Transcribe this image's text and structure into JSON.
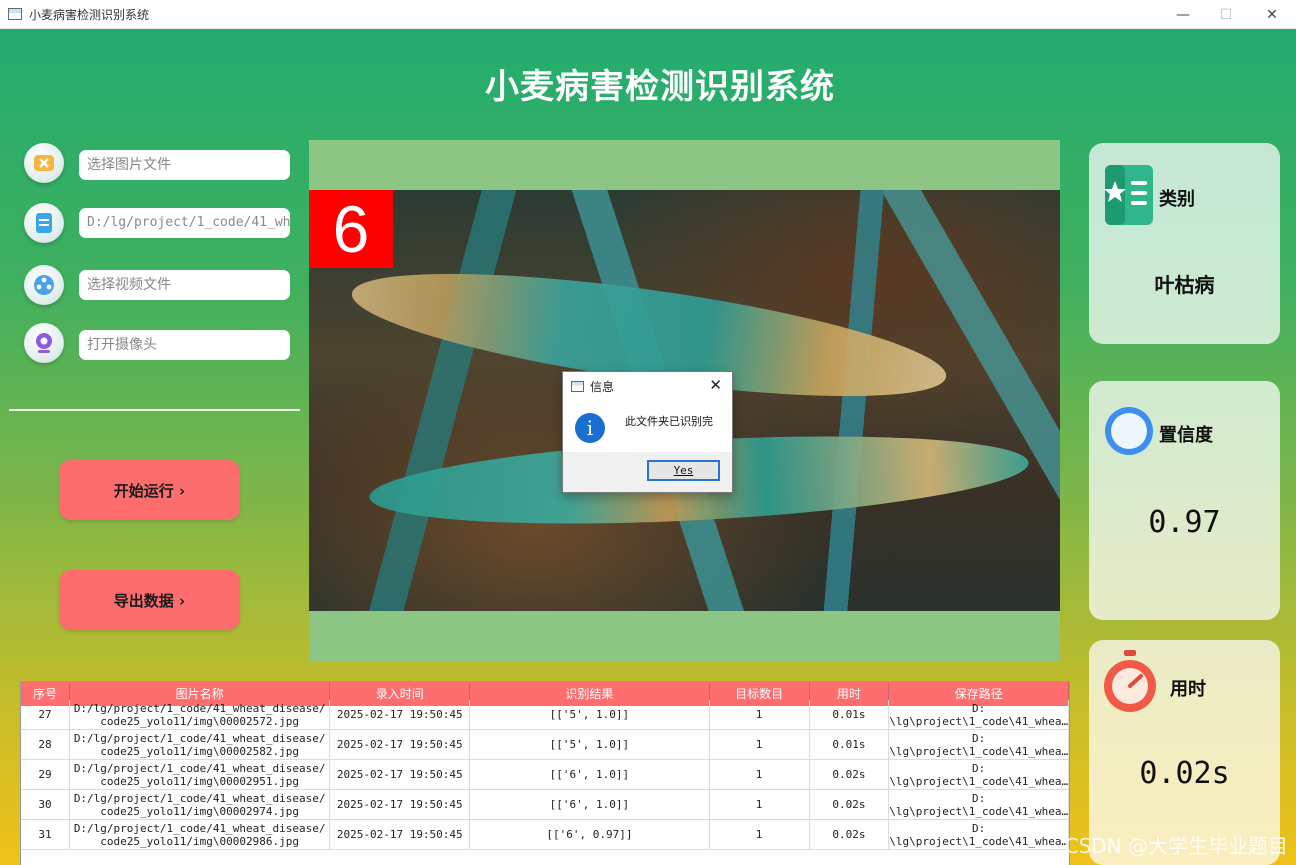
{
  "window": {
    "title": "小麦病害检测识别系统",
    "controls": {
      "minimize": "—",
      "maximize": "☐",
      "close": "✕"
    }
  },
  "app": {
    "title": "小麦病害检测识别系统"
  },
  "inputs": {
    "image_file": {
      "placeholder": "选择图片文件",
      "icon": "image-file-icon"
    },
    "folder": {
      "value": "D:/lg/project/1_code/41_wh",
      "icon": "folder-doc-icon"
    },
    "video_file": {
      "placeholder": "选择视频文件",
      "icon": "video-reel-icon"
    },
    "camera": {
      "placeholder": "打开摄像头",
      "icon": "camera-icon"
    }
  },
  "buttons": {
    "start": "开始运行 ›",
    "export": "导出数据 ›"
  },
  "detection_view": {
    "label": "6"
  },
  "dialog": {
    "title": "信息",
    "message": "此文件夹已识别完",
    "yes_button": "Yes",
    "close": "✕",
    "info_glyph": "i"
  },
  "table": {
    "headers": [
      "序号",
      "图片名称",
      "录入时间",
      "识别结果",
      "目标数目",
      "用时",
      "保存路径"
    ],
    "rows": [
      [
        "27",
        "D:/lg/project/1_code/41_wheat_disease/\ncode25_yolo11/img\\00002572.jpg",
        "2025-02-17 19:50:45",
        "[['5', 1.0]]",
        "1",
        "0.01s",
        "D:\n\\lg\\project\\1_code\\41_whea…"
      ],
      [
        "28",
        "D:/lg/project/1_code/41_wheat_disease/\ncode25_yolo11/img\\00002582.jpg",
        "2025-02-17 19:50:45",
        "[['5', 1.0]]",
        "1",
        "0.01s",
        "D:\n\\lg\\project\\1_code\\41_whea…"
      ],
      [
        "29",
        "D:/lg/project/1_code/41_wheat_disease/\ncode25_yolo11/img\\00002951.jpg",
        "2025-02-17 19:50:45",
        "[['6', 1.0]]",
        "1",
        "0.02s",
        "D:\n\\lg\\project\\1_code\\41_whea…"
      ],
      [
        "30",
        "D:/lg/project/1_code/41_wheat_disease/\ncode25_yolo11/img\\00002974.jpg",
        "2025-02-17 19:50:45",
        "[['6', 1.0]]",
        "1",
        "0.02s",
        "D:\n\\lg\\project\\1_code\\41_whea…"
      ],
      [
        "31",
        "D:/lg/project/1_code/41_wheat_disease/\ncode25_yolo11/img\\00002986.jpg",
        "2025-02-17 19:50:45",
        "[['6', 0.97]]",
        "1",
        "0.02s",
        "D:\n\\lg\\project\\1_code\\41_whea…"
      ]
    ]
  },
  "cards": {
    "category": {
      "label": "类别",
      "value": "叶枯病",
      "icon": "book-star-icon"
    },
    "confidence": {
      "label": "置信度",
      "value": "0.97",
      "icon": "circle-ring-icon"
    },
    "time": {
      "label": "用时",
      "value": "0.02s",
      "icon": "stopwatch-icon"
    }
  },
  "watermark": "CSDN @大学生毕业题目",
  "colors": {
    "accent_red": "#fe6d6d",
    "header_red": "#ff6e6e",
    "gradient_top": "#23ac6f",
    "gradient_bottom": "#efc219"
  }
}
